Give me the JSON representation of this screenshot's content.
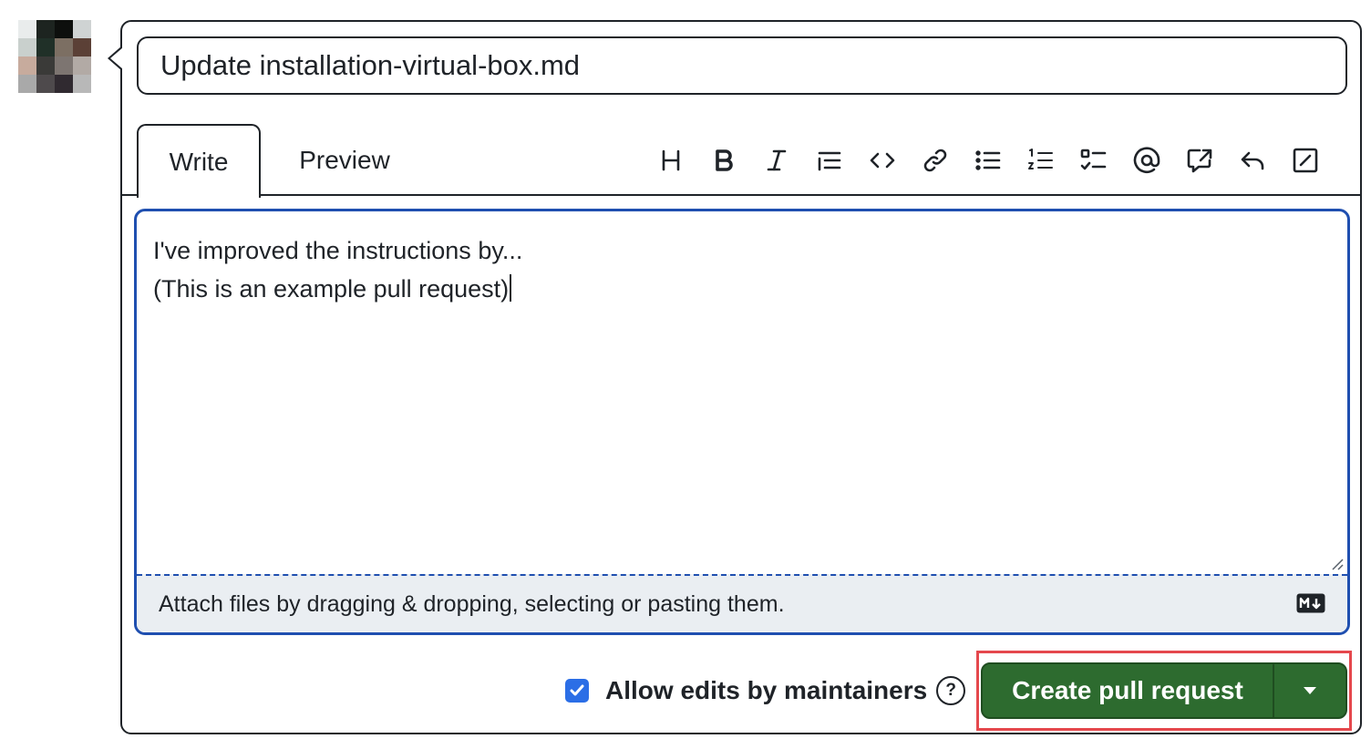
{
  "avatar": {
    "pixels": [
      "#e9ecec",
      "#1d2420",
      "#0d0f0d",
      "#cfd3d3",
      "#c9d0cd",
      "#203028",
      "#7c6f63",
      "#5b4036",
      "#c7ab9d",
      "#3a3a38",
      "#7d7571",
      "#b2aaa5",
      "#a9a9a9",
      "#4e4a4c",
      "#302a30",
      "#b8b8b8"
    ]
  },
  "pr": {
    "title_value": "Update installation-virtual-box.md"
  },
  "tabs": {
    "write": "Write",
    "preview": "Preview"
  },
  "toolbar": {
    "icons": [
      "heading-icon",
      "bold-icon",
      "italic-icon",
      "quote-icon",
      "code-icon",
      "link-icon",
      "unordered-list-icon",
      "ordered-list-icon",
      "task-list-icon",
      "mention-icon",
      "cross-reference-icon",
      "reply-icon",
      "fullscreen-icon"
    ]
  },
  "editor": {
    "line1": "I've improved the instructions by...",
    "line2": "(This is an example pull request)",
    "attach_hint": "Attach files by dragging & dropping, selecting or pasting them.",
    "markdown_icon": "markdown-icon"
  },
  "footer": {
    "allow_edits_label": "Allow edits by maintainers",
    "allow_edits_checked": true,
    "help_glyph": "?",
    "create_button_label": "Create pull request"
  },
  "colors": {
    "primary_button": "#2d6b2f",
    "focus_border": "#1f4fb0",
    "checkbox": "#2b6ee6",
    "highlight": "#e5484d"
  }
}
